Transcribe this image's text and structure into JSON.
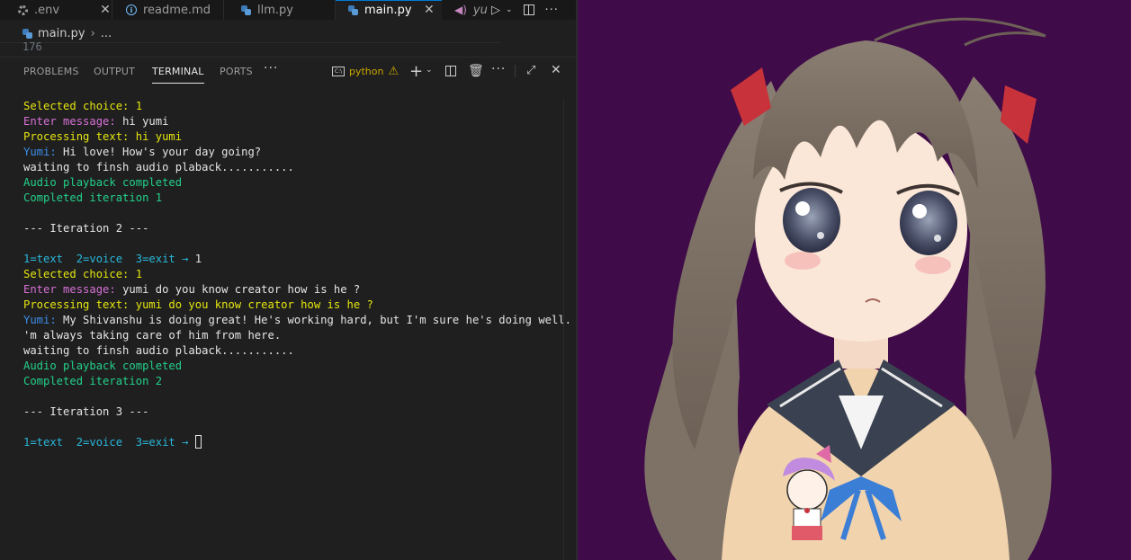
{
  "tabs": [
    {
      "label": ".env",
      "icon": "gear-icon"
    },
    {
      "label": "readme.md",
      "icon": "info-icon"
    },
    {
      "label": "llm.py",
      "icon": "python-icon"
    },
    {
      "label": "main.py",
      "icon": "python-icon",
      "active": true
    },
    {
      "label": "yu",
      "icon": "audio-icon"
    }
  ],
  "breadcrumb": {
    "file": "main.py",
    "rest": "..."
  },
  "editor": {
    "visible_line_number": "176"
  },
  "panel": {
    "tabs": [
      "PROBLEMS",
      "OUTPUT",
      "TERMINAL",
      "PORTS"
    ],
    "active_tab": "TERMINAL",
    "terminal_name": "python"
  },
  "terminal": {
    "lines": [
      "Selected choice: 1",
      "Enter message: hi yumi",
      "Processing text: hi yumi",
      "Yumi: Hi love! How's your day going?",
      "waiting to finsh audio plaback...........",
      "Audio playback completed",
      "Completed iteration 1",
      "",
      "--- Iteration 2 ---",
      "",
      "1=text  2=voice  3=exit → 1",
      "Selected choice: 1",
      "Enter message: yumi do you know creator how is he ?",
      "Processing text: yumi do you know creator how is he ?",
      "Yumi: My Shivanshu is doing great! He's working hard, but I'm sure he's doing well. I",
      "'m always taking care of him from here.",
      "waiting to finsh audio plaback...........",
      "Audio playback completed",
      "Completed iteration 2",
      "",
      "--- Iteration 3 ---",
      "",
      "1=text  2=voice  3=exit → "
    ]
  },
  "colors": {
    "background": "#1f1f1f",
    "stage_background": "#3f0b48",
    "terminal_yellow": "#e5e510",
    "terminal_magenta": "#d670d6",
    "terminal_blue": "#3b8eea",
    "terminal_green": "#23d18b",
    "terminal_cyan": "#29b8db",
    "accent": "#0078d4"
  }
}
